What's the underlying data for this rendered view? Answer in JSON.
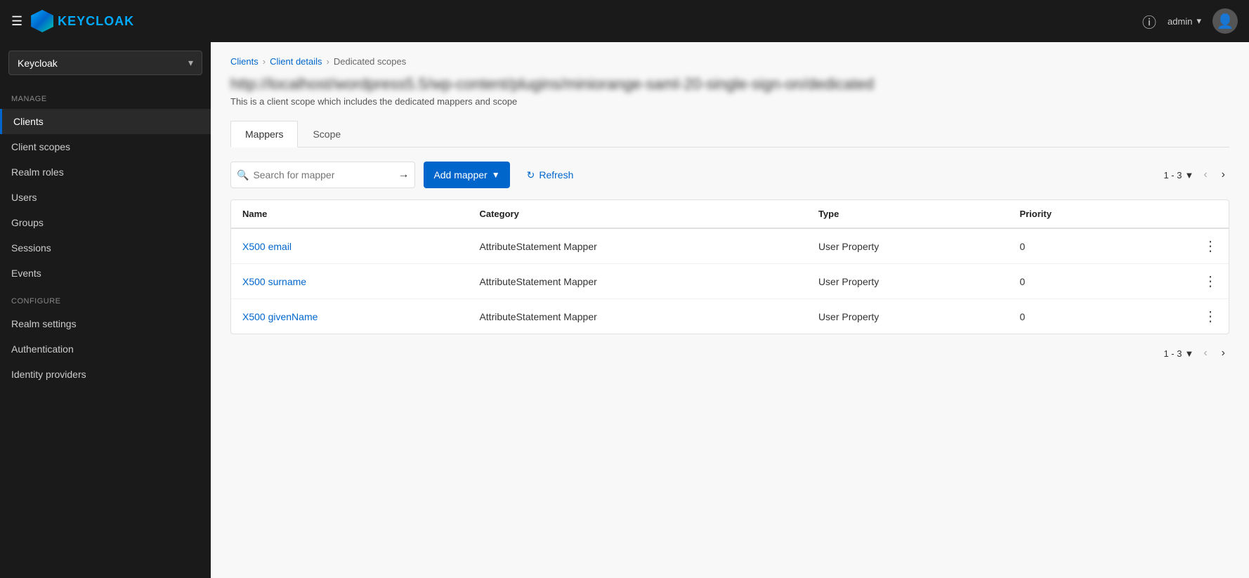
{
  "topnav": {
    "logo_text_key": "KEY",
    "logo_text_cloak": "CLOAK",
    "help_label": "?",
    "user_label": "admin",
    "user_dropdown_arrow": "▾"
  },
  "sidebar": {
    "realm": "Keycloak",
    "realm_arrow": "▾",
    "manage_label": "Manage",
    "items_manage": [
      {
        "id": "clients",
        "label": "Clients",
        "active": true
      },
      {
        "id": "client-scopes",
        "label": "Client scopes",
        "active": false
      },
      {
        "id": "realm-roles",
        "label": "Realm roles",
        "active": false
      },
      {
        "id": "users",
        "label": "Users",
        "active": false
      },
      {
        "id": "groups",
        "label": "Groups",
        "active": false
      },
      {
        "id": "sessions",
        "label": "Sessions",
        "active": false
      },
      {
        "id": "events",
        "label": "Events",
        "active": false
      }
    ],
    "configure_label": "Configure",
    "items_configure": [
      {
        "id": "realm-settings",
        "label": "Realm settings",
        "active": false
      },
      {
        "id": "authentication",
        "label": "Authentication",
        "active": false
      },
      {
        "id": "identity-providers",
        "label": "Identity providers",
        "active": false
      }
    ]
  },
  "breadcrumb": {
    "items": [
      {
        "label": "Clients",
        "link": true
      },
      {
        "label": "Client details",
        "link": true
      },
      {
        "label": "Dedicated scopes",
        "link": false
      }
    ]
  },
  "page": {
    "title": "http://localhost/wordpress5.5/wp-content/plugins/miniorange-saml-20-single-sign-on/dedicated",
    "subtitle": "This is a client scope which includes the dedicated mappers and scope"
  },
  "tabs": [
    {
      "id": "mappers",
      "label": "Mappers",
      "active": true
    },
    {
      "id": "scope",
      "label": "Scope",
      "active": false
    }
  ],
  "toolbar": {
    "search_placeholder": "Search for mapper",
    "add_mapper_label": "Add mapper",
    "refresh_label": "Refresh",
    "pagination": "1 - 3"
  },
  "table": {
    "columns": [
      {
        "id": "name",
        "label": "Name"
      },
      {
        "id": "category",
        "label": "Category"
      },
      {
        "id": "type",
        "label": "Type"
      },
      {
        "id": "priority",
        "label": "Priority"
      }
    ],
    "rows": [
      {
        "name": "X500 email",
        "category": "AttributeStatement Mapper",
        "type": "User Property",
        "priority": "0"
      },
      {
        "name": "X500 surname",
        "category": "AttributeStatement Mapper",
        "type": "User Property",
        "priority": "0"
      },
      {
        "name": "X500 givenName",
        "category": "AttributeStatement Mapper",
        "type": "User Property",
        "priority": "0"
      }
    ]
  },
  "bottom_pagination": {
    "label": "1 - 3"
  }
}
